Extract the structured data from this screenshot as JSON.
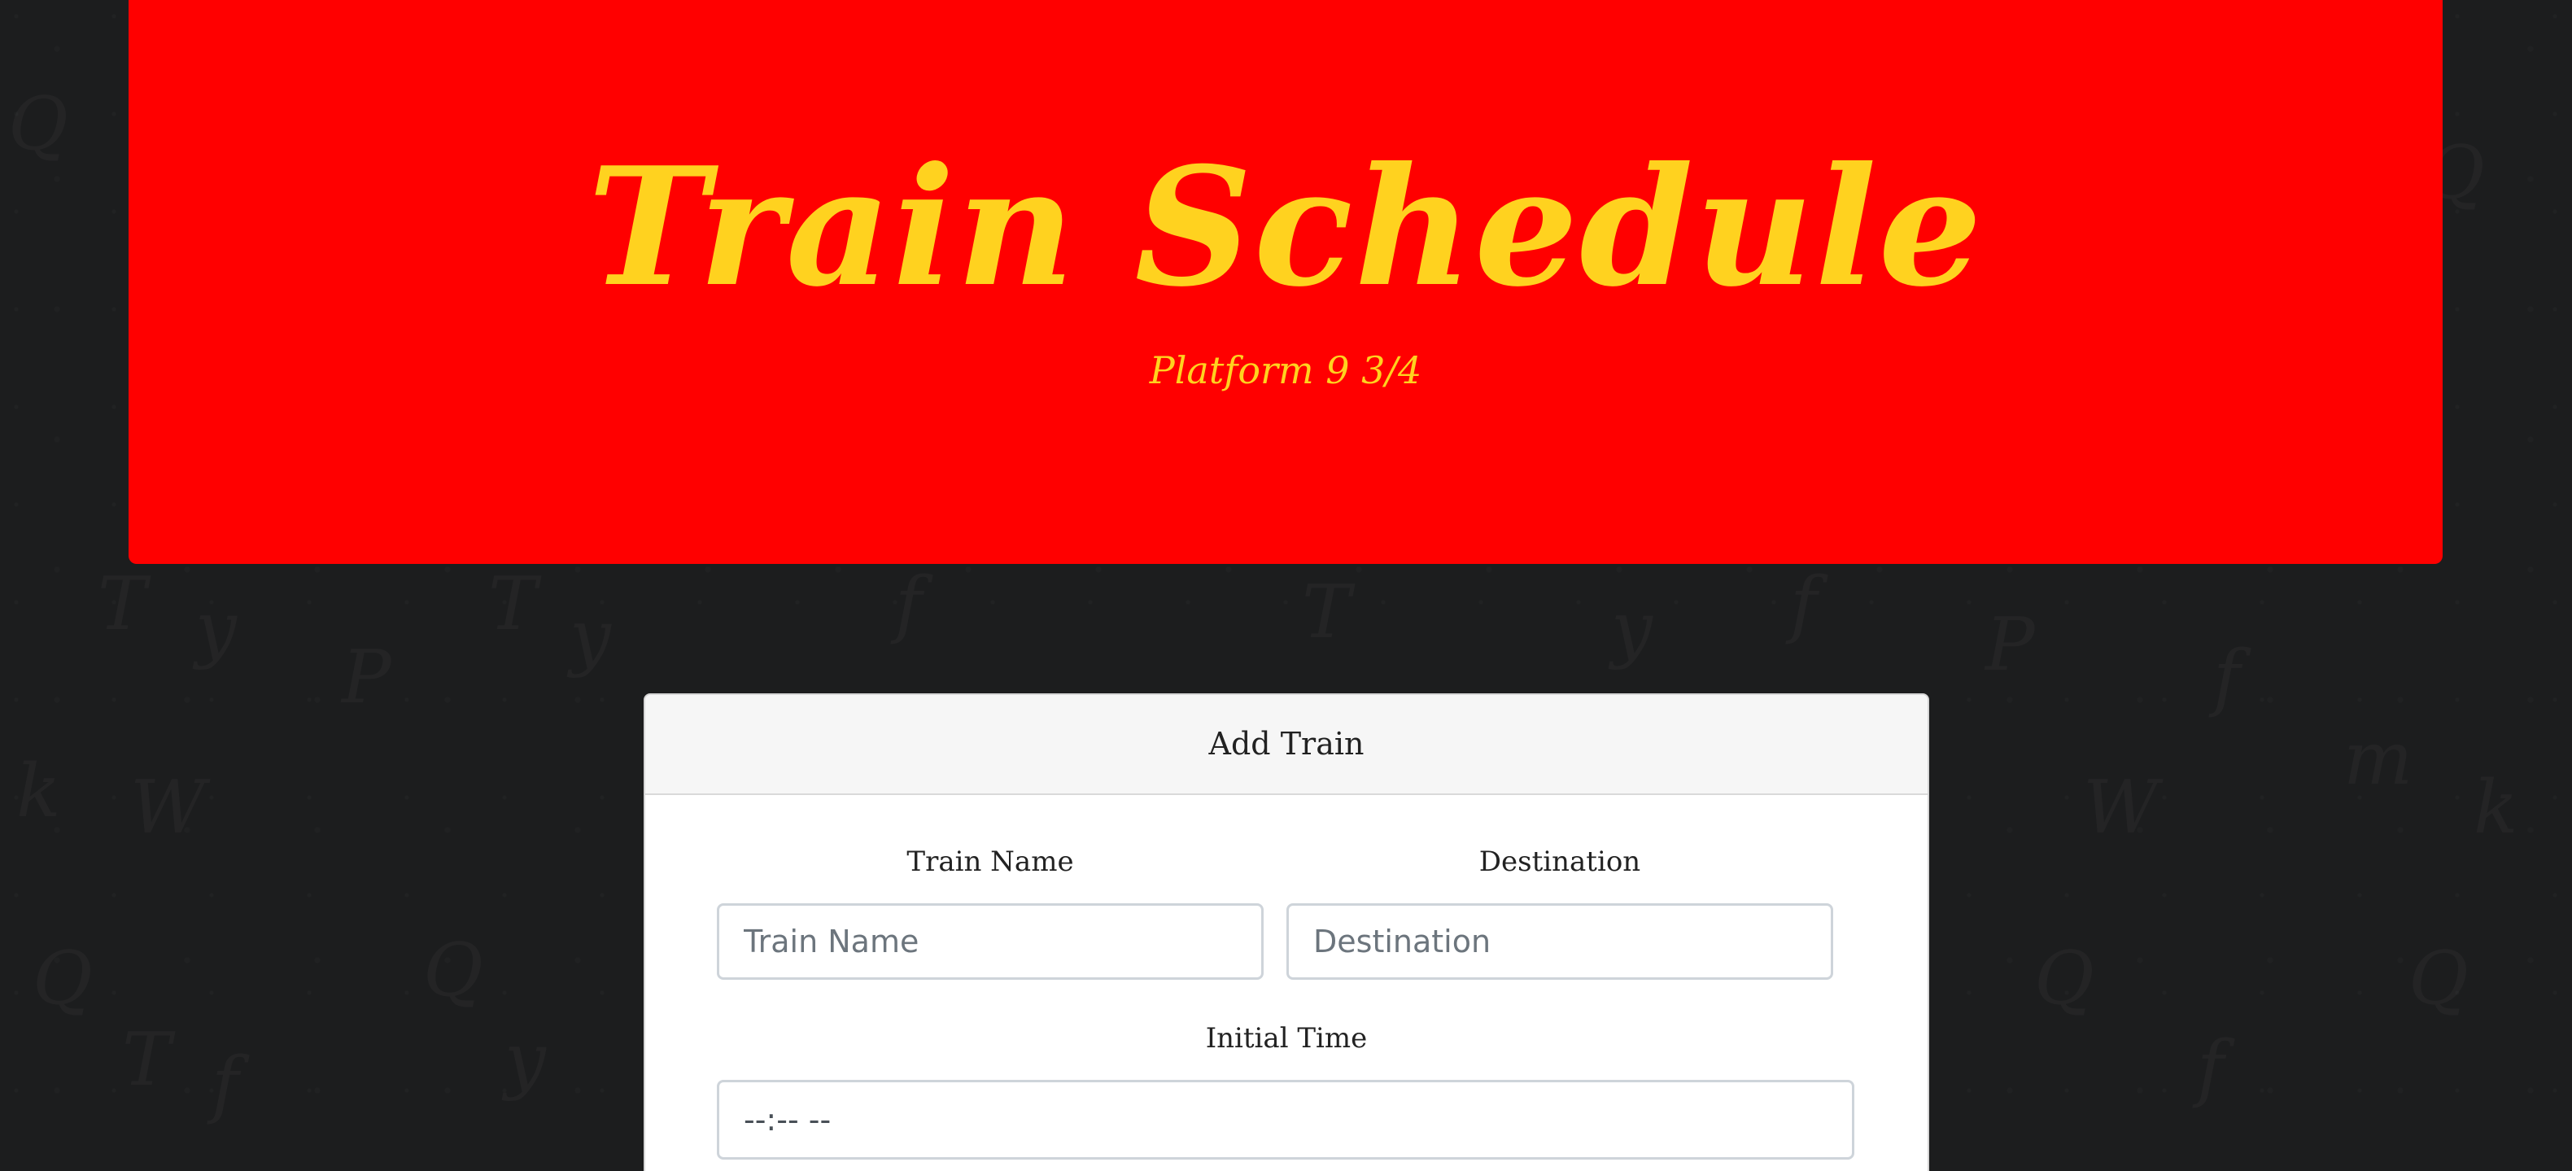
{
  "header": {
    "title": "Train Schedule",
    "subtitle": "Platform 9 3/4"
  },
  "form_card": {
    "title": "Add Train",
    "train_name": {
      "label": "Train Name",
      "placeholder": "Train Name",
      "value": ""
    },
    "destination": {
      "label": "Destination",
      "placeholder": "Destination",
      "value": ""
    },
    "initial_time": {
      "label": "Initial Time",
      "display": "--:-- --"
    }
  },
  "colors": {
    "page_background": "#1c1d1e",
    "jumbotron_background": "#ff0000",
    "heading_text": "#ffd21f",
    "card_header_background": "#f6f6f6",
    "input_border": "#ced4da"
  }
}
